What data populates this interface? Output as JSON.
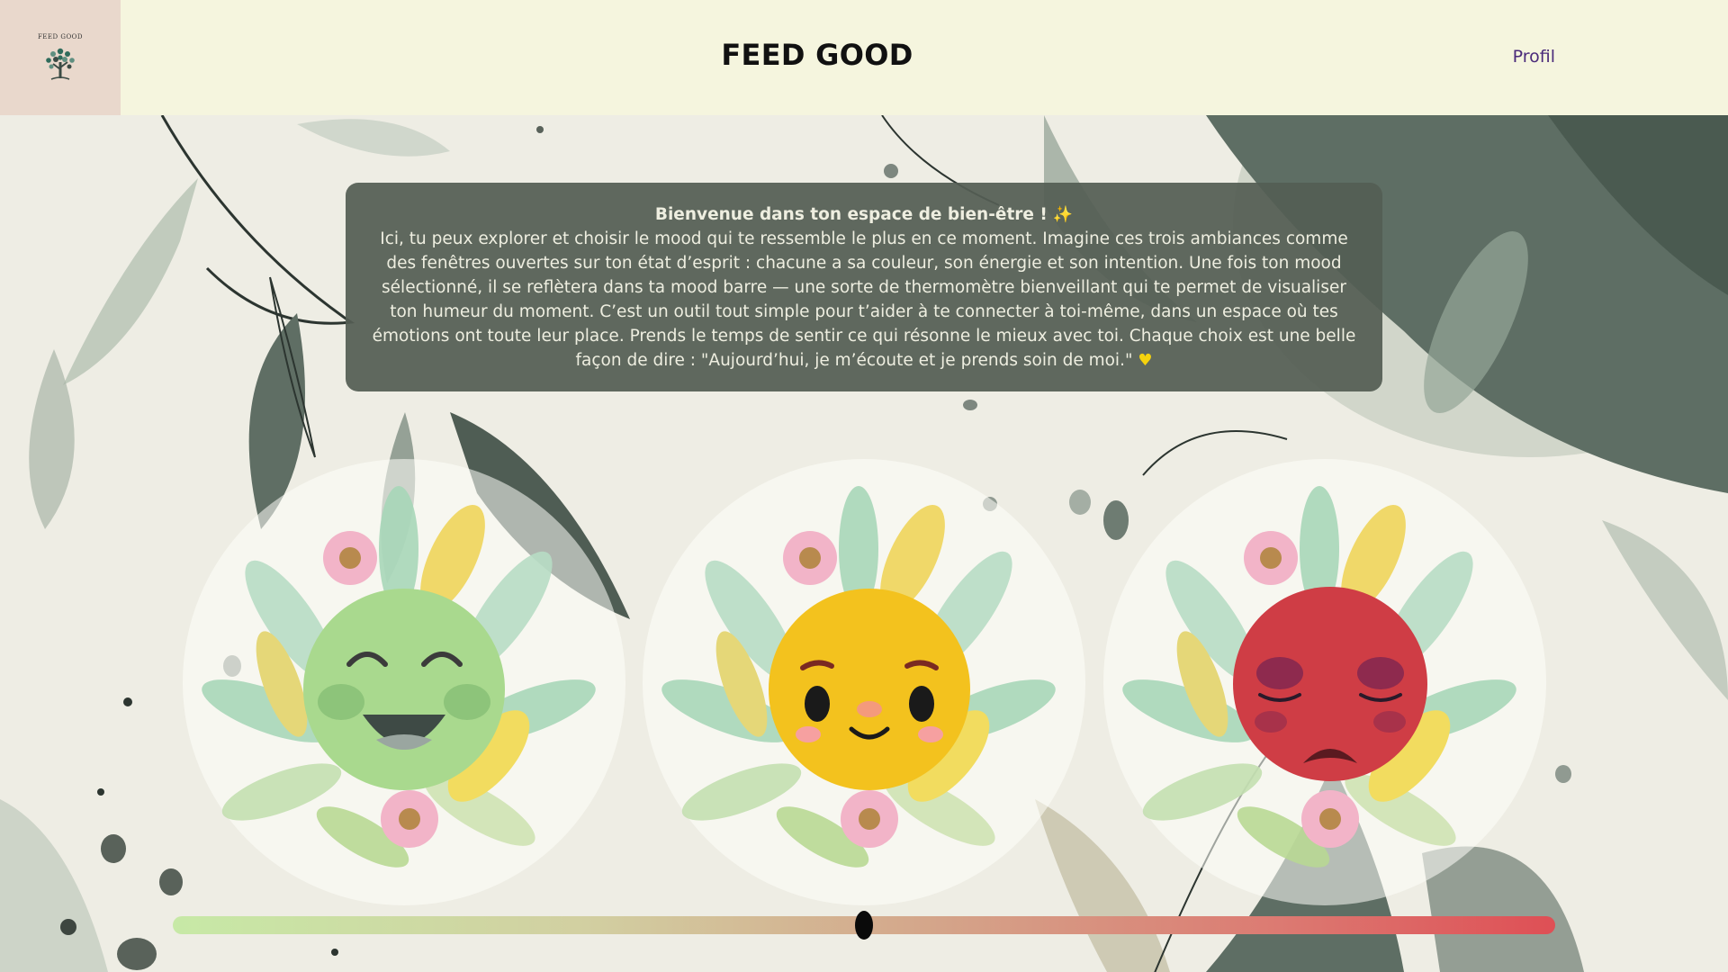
{
  "header": {
    "logo_text": "FEED GOOD",
    "title": "FEED GOOD",
    "profile_link": "Profil"
  },
  "welcome": {
    "title": "Bienvenue dans ton espace de bien-être !",
    "title_icon": "sparkles",
    "body": "Ici, tu peux explorer et choisir le mood qui te ressemble le plus en ce moment. Imagine ces trois ambiances comme des fenêtres ouvertes sur ton état d’esprit : chacune a sa couleur, son énergie et son intention. Une fois ton mood sélectionné, il se reflètera dans ta mood barre — une sorte de thermomètre bienveillant qui te permet de visualiser ton humeur du moment. C’est un outil tout simple pour t’aider à te connecter à toi-même, dans un espace où tes émotions ont toute leur place. Prends le temps de sentir ce qui résonne le mieux avec toi. Chaque choix est une belle façon de dire : \"Aujourd’hui, je m’écoute et je prends soin de moi.\"",
    "end_icon": "yellow-heart"
  },
  "moods": [
    {
      "name": "happy",
      "color": "#a9d98e"
    },
    {
      "name": "content",
      "color": "#f3c21e"
    },
    {
      "name": "sad",
      "color": "#cf3d45"
    }
  ],
  "mood_bar": {
    "value": 0.5,
    "gradient_start": "#c7e9a6",
    "gradient_end": "#de4f55"
  },
  "colors": {
    "header_bg": "#f5f5de",
    "logo_bg": "#e9d8cc",
    "panel_bg": "#545e54",
    "link": "#4a2a7a"
  }
}
